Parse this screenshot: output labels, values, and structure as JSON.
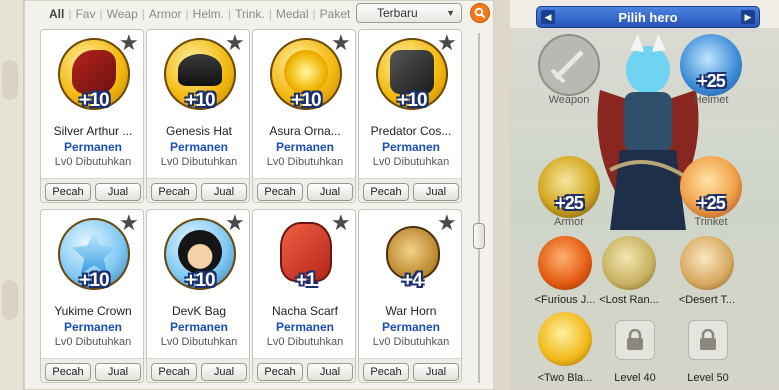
{
  "filters": [
    "All",
    "Fav",
    "Weap",
    "Armor",
    "Helm.",
    "Trink.",
    "Medal",
    "Paket"
  ],
  "sort": {
    "selected": "Terbaru"
  },
  "actions": {
    "pecah": "Pecah",
    "jual": "Jual"
  },
  "items": [
    {
      "name": "Silver Arthur ...",
      "plus": "+10",
      "status": "Permanen",
      "req": "Lv0 Dibutuhkan"
    },
    {
      "name": "Genesis Hat",
      "plus": "+10",
      "status": "Permanen",
      "req": "Lv0 Dibutuhkan"
    },
    {
      "name": "Asura Orna...",
      "plus": "+10",
      "status": "Permanen",
      "req": "Lv0 Dibutuhkan"
    },
    {
      "name": "Predator Cos...",
      "plus": "+10",
      "status": "Permanen",
      "req": "Lv0 Dibutuhkan"
    },
    {
      "name": "Yukime Crown",
      "plus": "+10",
      "status": "Permanen",
      "req": "Lv0 Dibutuhkan"
    },
    {
      "name": "DevK Bag",
      "plus": "+10",
      "status": "Permanen",
      "req": "Lv0 Dibutuhkan"
    },
    {
      "name": "Nacha Scarf",
      "plus": "+1",
      "status": "Permanen",
      "req": "Lv0 Dibutuhkan"
    },
    {
      "name": "War Horn",
      "plus": "+4",
      "status": "Permanen",
      "req": "Lv0 Dibutuhkan"
    }
  ],
  "hero": {
    "title": "Pilih hero",
    "weapon_label": "Weapon",
    "helmet": {
      "label": "Helmet",
      "plus": "+25"
    },
    "armor": {
      "label": "Armor",
      "plus": "+25"
    },
    "trinket": {
      "label": "Trinket",
      "plus": "+25"
    },
    "skills": [
      {
        "label": "<Furious J..."
      },
      {
        "label": "<Lost Ran..."
      },
      {
        "label": "<Desert T..."
      },
      {
        "label": "<Two Bla..."
      }
    ],
    "locked": [
      {
        "label": "Level 40"
      },
      {
        "label": "Level 50"
      }
    ]
  }
}
